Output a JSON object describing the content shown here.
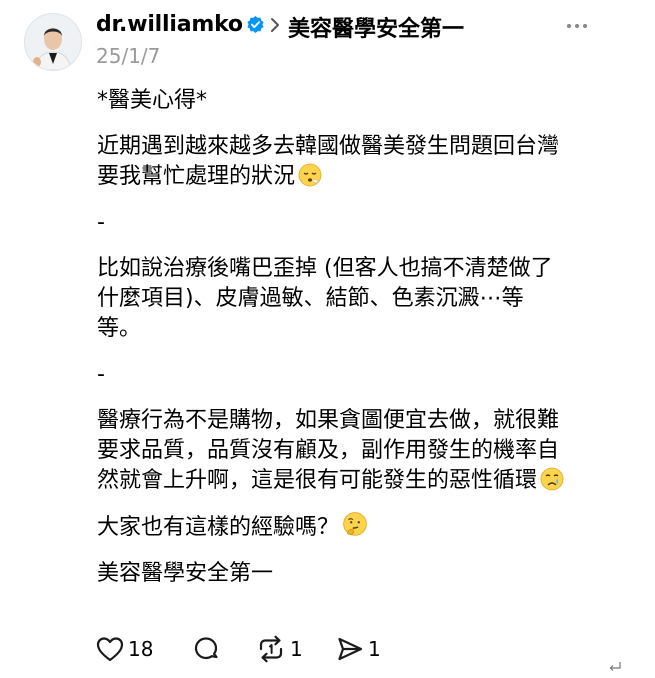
{
  "header": {
    "username": "dr.williamko",
    "topic": "美容醫學安全第一",
    "date": "25/1/7"
  },
  "post": {
    "heading": "*醫美心得*",
    "paragraph1_line1": "近期遇到越來越多去韓國做醫美發生問題回台灣",
    "paragraph1_line2": "要我幫忙處理的狀況",
    "sep1": "-",
    "paragraph2_line1": "比如說治療後嘴巴歪掉 (但客人也搞不清楚做了",
    "paragraph2_line2": "什麼項目)、皮膚過敏、結節、色素沉澱⋯等",
    "paragraph2_line3": "等。",
    "sep2": "-",
    "paragraph3_line1": "醫療行為不是購物，如果貪圖便宜去做，就很難",
    "paragraph3_line2": "要求品質，品質沒有顧及，副作用發生的機率自",
    "paragraph3_line3": "然就會上升啊，這是很有可能發生的惡性循環",
    "question": "大家也有這樣的經驗嗎？",
    "closing": "美容醫學安全第一"
  },
  "actions": {
    "likes": "18",
    "reposts": "1",
    "shares": "1"
  },
  "colors": {
    "verified": "#0095f6",
    "muted": "#9a9a9a",
    "icon": "#1a1a1a"
  },
  "icons": [
    "verified-badge-icon",
    "chevron-right-icon",
    "more-icon",
    "heart-icon",
    "comment-icon",
    "repost-icon",
    "share-icon",
    "return-icon"
  ]
}
